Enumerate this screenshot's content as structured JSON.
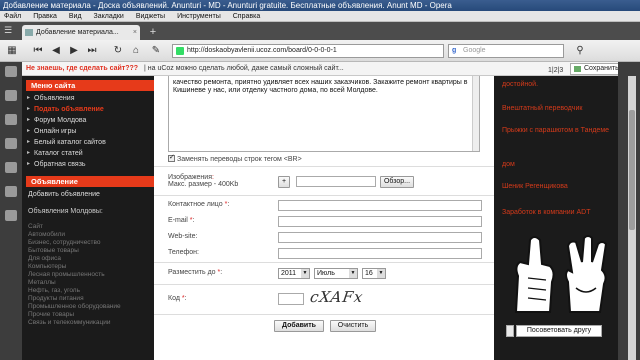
{
  "window": {
    "title": "Добавление материала - Доска объявлений. Anunturi - MD - Anunturi gratuite. Бесплатные объявления. Anunt MD - Opera"
  },
  "menu": [
    "Файл",
    "Правка",
    "Вид",
    "Закладки",
    "Виджеты",
    "Инструменты",
    "Справка"
  ],
  "tab": {
    "label": "Добавление материала...",
    "close": "×"
  },
  "address": {
    "url": "http://doskaobyavlenii.ucoz.com/board/0-0-0-0-1"
  },
  "search": {
    "placeholder": "Google"
  },
  "infobar": {
    "question": "Не знаешь, где сделать сайт???",
    "text": "| на uCoz можно сделать любой, даже самый сложный сайт...",
    "pager": "1|2|3",
    "save_label": "Сохранить сайт"
  },
  "leftnav": {
    "site_menu_title": "Меню сайта",
    "site_menu": [
      "Объявления",
      "Подать объявление",
      "Форум Молдова",
      "Онлайн игры",
      "Белый каталог сайтов",
      "Каталог статей",
      "Обратная связь"
    ],
    "ad_title": "Объявление",
    "add_ad": "Добавить объявление",
    "md_ads": "Объявления Молдовы:",
    "categories": [
      "Сайт",
      "Автомобили",
      "Бизнес, сотрудничество",
      "Бытовые товары",
      "Для офиса",
      "Компьютеры",
      "Лесная промышленность",
      "Металлы",
      "Нефть, газ, уголь",
      "Продукты питания",
      "Промышленное оборудование",
      "Прочие товары",
      "Связь и телекоммуникации"
    ]
  },
  "form": {
    "textarea_text": "качество ремонта, приятно удивляет всех наших заказчиков. Закажите ремонт квартиры в Кишиневе у нас, или отделку частного дома, по всей Молдове.",
    "replace_linebreaks": "Заменять переводы строк тегом <BR>",
    "images_label": "Изображения",
    "images_max": "Макс. размер - 400Kb",
    "add_btn": "+",
    "browse_btn": "Обзор...",
    "contact_label": "Контактное лицо",
    "email_label": "E-mail",
    "website_label": "Web-site:",
    "phone_label": "Телефон:",
    "post_until_label": "Разместить до",
    "year": "2011",
    "month": "Июль",
    "day": "16",
    "code_label": "Код",
    "captcha_text": "cXAFx",
    "submit_btn": "Добавить",
    "clear_btn": "Очистить"
  },
  "rightcol": {
    "links": [
      "достойной.",
      "Внештатный переводчик",
      "Прыжки с парашютом в Тандеме",
      "дом",
      "Шеник Регенщикова",
      "Заработок в компании ADT"
    ],
    "share_btn": "Посоветовать другу"
  }
}
